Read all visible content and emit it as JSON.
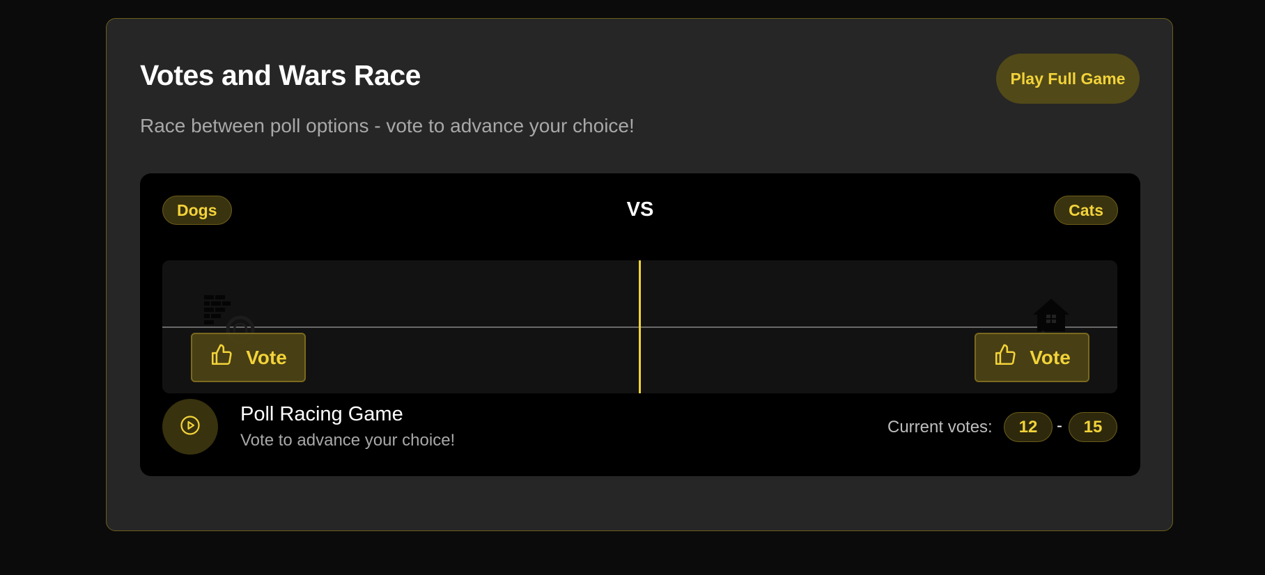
{
  "header": {
    "title": "Votes and Wars Race",
    "subtitle": "Race between poll options - vote to advance your choice!",
    "play_full_label": "Play Full Game"
  },
  "race": {
    "option_a": "Dogs",
    "option_b": "Cats",
    "vs_label": "VS",
    "vote_label_a": "Vote",
    "vote_label_b": "Vote",
    "racer_a_icon": "brick-wall-icon",
    "racer_b_icon": "house-icon"
  },
  "footer": {
    "game_name": "Poll Racing Game",
    "game_desc": "Vote to advance your choice!",
    "votes_label": "Current votes:",
    "votes_a": "12",
    "votes_separator": "-",
    "votes_b": "15"
  },
  "colors": {
    "accent": "#f2d33a",
    "background": "#0b0b0b",
    "card": "#262626",
    "border": "#6b5f1e"
  }
}
